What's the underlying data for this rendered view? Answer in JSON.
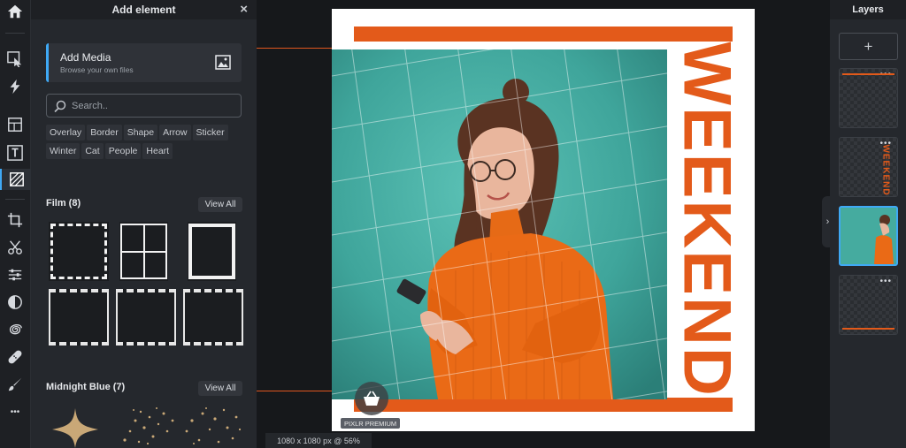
{
  "panel": {
    "title": "Add element",
    "close_icon": "×",
    "add_media": {
      "title": "Add Media",
      "subtitle": "Browse your own files"
    },
    "search_placeholder": "Search..",
    "tags": [
      "Overlay",
      "Border",
      "Shape",
      "Arrow",
      "Sticker",
      "Winter",
      "Cat",
      "People",
      "Heart"
    ],
    "sections": [
      {
        "title": "Film (8)",
        "view_all": "View All"
      },
      {
        "title": "Midnight Blue (7)",
        "view_all": "View All"
      }
    ]
  },
  "toolbar": {
    "icons": [
      "home-icon",
      "arrange-icon",
      "cutout-icon",
      "layout-icon",
      "text-icon",
      "element-icon",
      "crop-icon",
      "cut-icon",
      "adjust-icon",
      "filter-icon",
      "liquify-icon",
      "heal-icon",
      "brush-icon",
      "more-icon"
    ],
    "more_glyph": "•••"
  },
  "canvas": {
    "title_text": "WEEKEND",
    "premium_label": "PIXLR PREMIUM",
    "status": "1080 x 1080 px @ 56%",
    "accent": "#e35a1a",
    "photo_bg": "#3fa59b"
  },
  "layers": {
    "title": "Layers",
    "add_glyph": "+",
    "collapse_glyph": "›",
    "more_glyph": "•••",
    "thumb_text": "WEEKEND"
  }
}
